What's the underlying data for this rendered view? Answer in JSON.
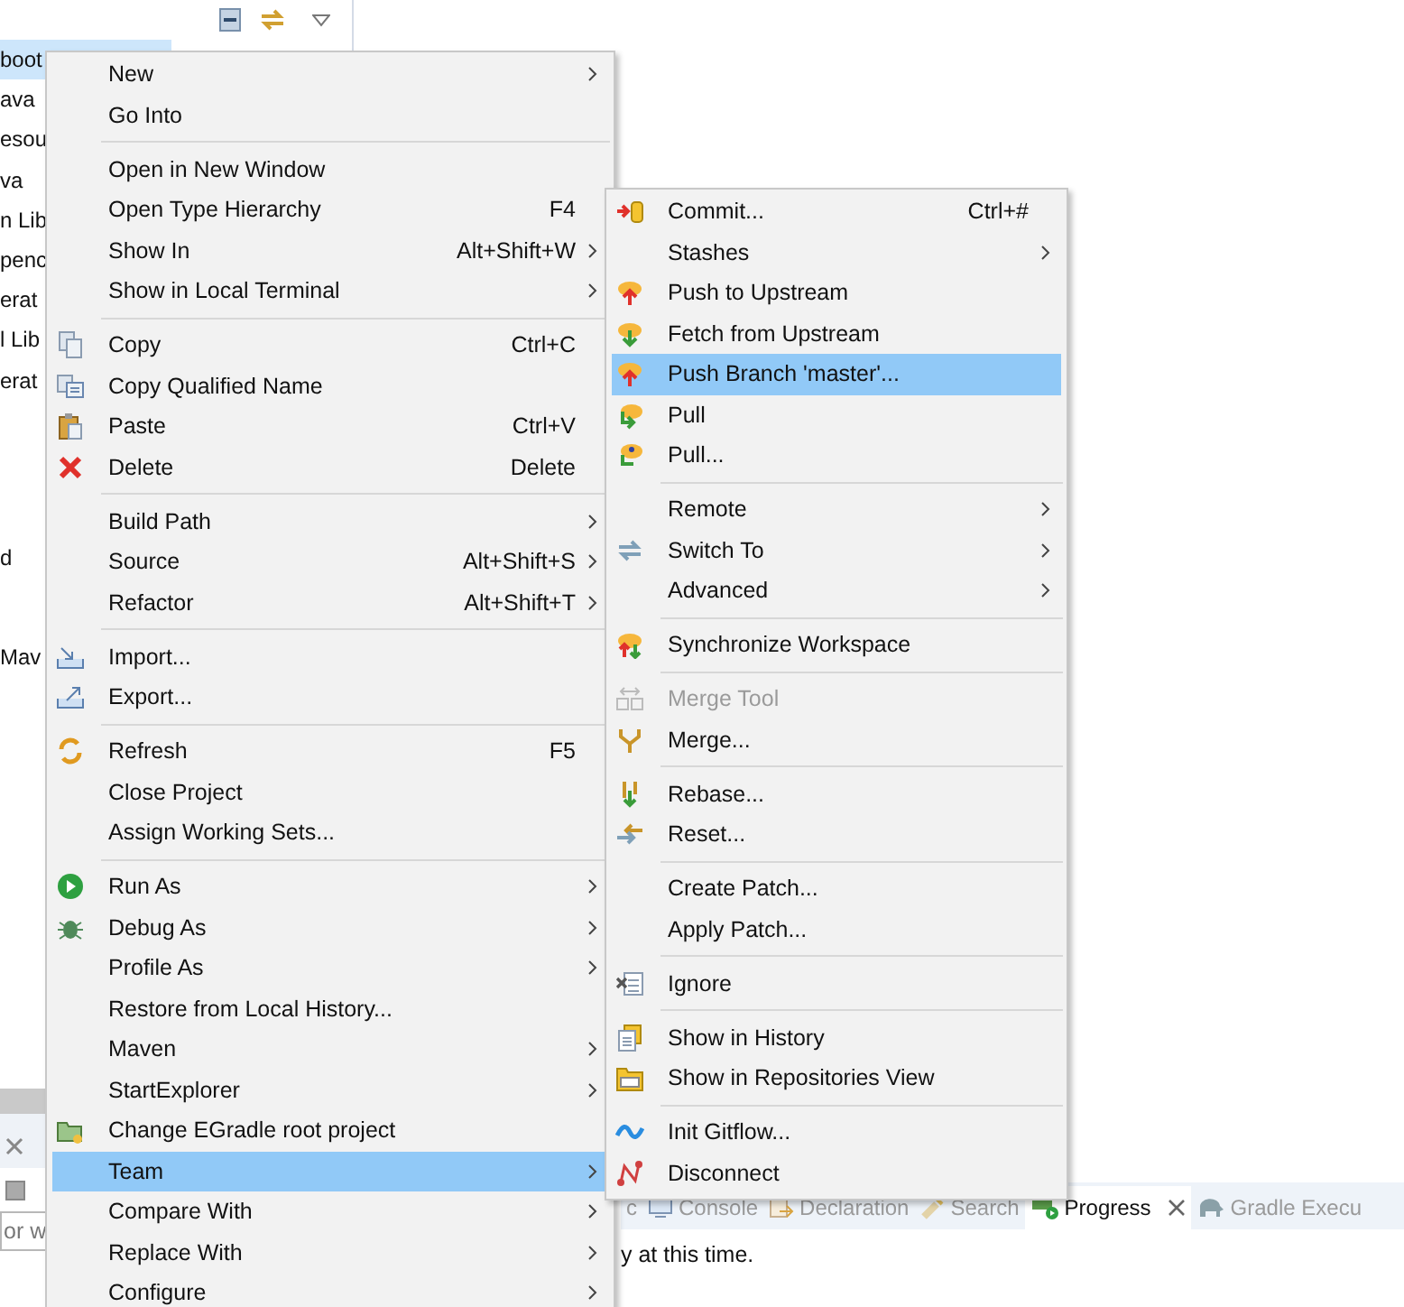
{
  "explorer": {
    "tree_rows": [
      {
        "label": "boot",
        "selected": true
      },
      {
        "label": "ava",
        "selected": false
      },
      {
        "label": "esou",
        "selected": false
      },
      {
        "label": "va",
        "selected": false
      },
      {
        "label": "n Lib",
        "selected": false
      },
      {
        "label": "penc",
        "selected": false
      },
      {
        "label": "erat",
        "selected": false
      },
      {
        "label": "l Lib",
        "selected": false
      },
      {
        "label": "erat",
        "selected": false
      },
      {
        "label": "d",
        "selected": false
      },
      {
        "label": "Mav",
        "selected": false
      }
    ]
  },
  "bottom_left": {
    "filter": {
      "placeholder": "or w"
    }
  },
  "context_menu": {
    "groups": [
      {
        "items": [
          {
            "label": "New",
            "submenu": true,
            "selected": false
          },
          {
            "label": "Go Into",
            "submenu": false,
            "selected": false
          }
        ]
      },
      {
        "items": [
          {
            "label": "Open in New Window",
            "submenu": false,
            "selected": false
          },
          {
            "label": "Open Type Hierarchy",
            "shortcut": "F4",
            "submenu": false,
            "selected": false
          },
          {
            "label": "Show In",
            "shortcut": "Alt+Shift+W",
            "submenu": true,
            "selected": false
          },
          {
            "label": "Show in Local Terminal",
            "submenu": true,
            "selected": false
          }
        ]
      },
      {
        "items": [
          {
            "label": "Copy",
            "shortcut": "Ctrl+C",
            "submenu": false,
            "selected": false
          },
          {
            "label": "Copy Qualified Name",
            "submenu": false,
            "selected": false
          },
          {
            "label": "Paste",
            "shortcut": "Ctrl+V",
            "submenu": false,
            "selected": false
          },
          {
            "label": "Delete",
            "shortcut": "Delete",
            "submenu": false,
            "selected": false
          }
        ]
      },
      {
        "items": [
          {
            "label": "Build Path",
            "submenu": true,
            "selected": false
          },
          {
            "label": "Source",
            "shortcut": "Alt+Shift+S",
            "submenu": true,
            "selected": false
          },
          {
            "label": "Refactor",
            "shortcut": "Alt+Shift+T",
            "submenu": true,
            "selected": false
          }
        ]
      },
      {
        "items": [
          {
            "label": "Import...",
            "submenu": false,
            "selected": false
          },
          {
            "label": "Export...",
            "submenu": false,
            "selected": false
          }
        ]
      },
      {
        "items": [
          {
            "label": "Refresh",
            "shortcut": "F5",
            "submenu": false,
            "selected": false
          },
          {
            "label": "Close Project",
            "submenu": false,
            "selected": false
          },
          {
            "label": "Assign Working Sets...",
            "submenu": false,
            "selected": false
          }
        ]
      },
      {
        "items": [
          {
            "label": "Run As",
            "submenu": true,
            "selected": false
          },
          {
            "label": "Debug As",
            "submenu": true,
            "selected": false
          },
          {
            "label": "Profile As",
            "submenu": true,
            "selected": false
          },
          {
            "label": "Restore from Local History...",
            "submenu": false,
            "selected": false
          },
          {
            "label": "Maven",
            "submenu": true,
            "selected": false
          },
          {
            "label": "StartExplorer",
            "submenu": true,
            "selected": false
          },
          {
            "label": "Change EGradle root project",
            "submenu": false,
            "selected": false
          },
          {
            "label": "Team",
            "submenu": true,
            "selected": true
          },
          {
            "label": "Compare With",
            "submenu": true,
            "selected": false
          },
          {
            "label": "Replace With",
            "submenu": true,
            "selected": false
          },
          {
            "label": "Configure",
            "submenu": true,
            "selected": false
          }
        ]
      }
    ]
  },
  "team_submenu": {
    "groups": [
      {
        "items": [
          {
            "label": "Commit...",
            "shortcut": "Ctrl+#",
            "submenu": false,
            "selected": false,
            "disabled": false
          },
          {
            "label": "Stashes",
            "submenu": true,
            "selected": false,
            "disabled": false
          },
          {
            "label": "Push to Upstream",
            "submenu": false,
            "selected": false,
            "disabled": false
          },
          {
            "label": "Fetch from Upstream",
            "submenu": false,
            "selected": false,
            "disabled": false
          },
          {
            "label": "Push Branch 'master'...",
            "submenu": false,
            "selected": true,
            "disabled": false
          },
          {
            "label": "Pull",
            "submenu": false,
            "selected": false,
            "disabled": false
          },
          {
            "label": "Pull...",
            "submenu": false,
            "selected": false,
            "disabled": false
          }
        ]
      },
      {
        "items": [
          {
            "label": "Remote",
            "submenu": true,
            "selected": false,
            "disabled": false
          },
          {
            "label": "Switch To",
            "submenu": true,
            "selected": false,
            "disabled": false
          },
          {
            "label": "Advanced",
            "submenu": true,
            "selected": false,
            "disabled": false
          }
        ]
      },
      {
        "items": [
          {
            "label": "Synchronize Workspace",
            "submenu": false,
            "selected": false,
            "disabled": false
          }
        ]
      },
      {
        "items": [
          {
            "label": "Merge Tool",
            "submenu": false,
            "selected": false,
            "disabled": true
          },
          {
            "label": "Merge...",
            "submenu": false,
            "selected": false,
            "disabled": false
          }
        ]
      },
      {
        "items": [
          {
            "label": "Rebase...",
            "submenu": false,
            "selected": false,
            "disabled": false
          },
          {
            "label": "Reset...",
            "submenu": false,
            "selected": false,
            "disabled": false
          }
        ]
      },
      {
        "items": [
          {
            "label": "Create Patch...",
            "submenu": false,
            "selected": false,
            "disabled": false
          },
          {
            "label": "Apply Patch...",
            "submenu": false,
            "selected": false,
            "disabled": false
          }
        ]
      },
      {
        "items": [
          {
            "label": "Ignore",
            "submenu": false,
            "selected": false,
            "disabled": false
          }
        ]
      },
      {
        "items": [
          {
            "label": "Show in History",
            "submenu": false,
            "selected": false,
            "disabled": false
          },
          {
            "label": "Show in Repositories View",
            "submenu": false,
            "selected": false,
            "disabled": false
          }
        ]
      },
      {
        "items": [
          {
            "label": "Init Gitflow...",
            "submenu": false,
            "selected": false,
            "disabled": false
          },
          {
            "label": "Disconnect",
            "submenu": false,
            "selected": false,
            "disabled": false
          }
        ]
      }
    ]
  },
  "bottom_panel": {
    "tabs": [
      {
        "label": "c",
        "selected": false
      },
      {
        "label": "Console",
        "selected": false
      },
      {
        "label": "Declaration",
        "selected": false
      },
      {
        "label": "Search",
        "selected": false
      },
      {
        "label": "Progress",
        "selected": true
      },
      {
        "label": "Gradle Execu",
        "selected": false
      }
    ],
    "message": "y at this time."
  }
}
